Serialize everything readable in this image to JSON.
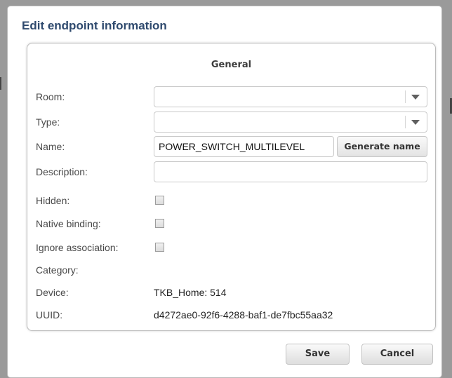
{
  "dialog": {
    "title": "Edit endpoint information"
  },
  "section": {
    "title": "General"
  },
  "labels": {
    "room": "Room:",
    "type": "Type:",
    "name": "Name:",
    "description": "Description:",
    "hidden": "Hidden:",
    "native_binding": "Native binding:",
    "ignore_association": "Ignore association:",
    "category": "Category:",
    "device": "Device:",
    "uuid": "UUID:"
  },
  "fields": {
    "room": "",
    "type": "",
    "name": "POWER_SWITCH_MULTILEVEL",
    "description": "",
    "hidden": false,
    "native_binding": false,
    "ignore_association": false,
    "category": "",
    "device": "TKB_Home: 514",
    "uuid": "d4272ae0-92f6-4288-baf1-de7fbc55aa32"
  },
  "buttons": {
    "generate_name": "Generate name",
    "save": "Save",
    "cancel": "Cancel"
  },
  "icons": {
    "dropdown": "chevron-down-icon"
  }
}
